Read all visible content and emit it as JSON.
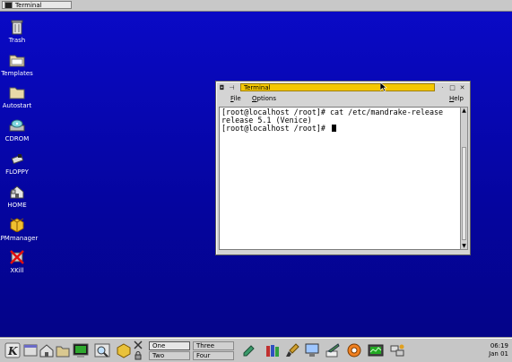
{
  "taskbar": {
    "task_label": "Terminal"
  },
  "desktop_icons": [
    {
      "label": "Trash",
      "icon": "trash-icon"
    },
    {
      "label": "Templates",
      "icon": "folder-icon"
    },
    {
      "label": "Autostart",
      "icon": "folder-icon"
    },
    {
      "label": "CDROM",
      "icon": "cdrom-icon"
    },
    {
      "label": "FLOPPY",
      "icon": "floppy-icon"
    },
    {
      "label": "HOME",
      "icon": "home-icon"
    },
    {
      "label": "RPMmanager",
      "icon": "package-icon"
    },
    {
      "label": "XKill",
      "icon": "xkill-icon"
    }
  ],
  "window": {
    "title": "Terminal",
    "menu": {
      "file": "File",
      "options": "Options",
      "help": "Help"
    },
    "terminal_lines": [
      "[root@localhost /root]# cat /etc/mandrake-release",
      "release 5.1 (Venice)",
      "[root@localhost /root]# "
    ]
  },
  "panel": {
    "desktops": [
      "One",
      "Three",
      "Two",
      "Four"
    ],
    "active_desktop": "One",
    "clock_time": "06:19",
    "clock_date": "Jan 01"
  },
  "colors": {
    "desktop_bg": "#0505a0",
    "title_active": "#f5c800",
    "panel": "#c6c6c6"
  }
}
